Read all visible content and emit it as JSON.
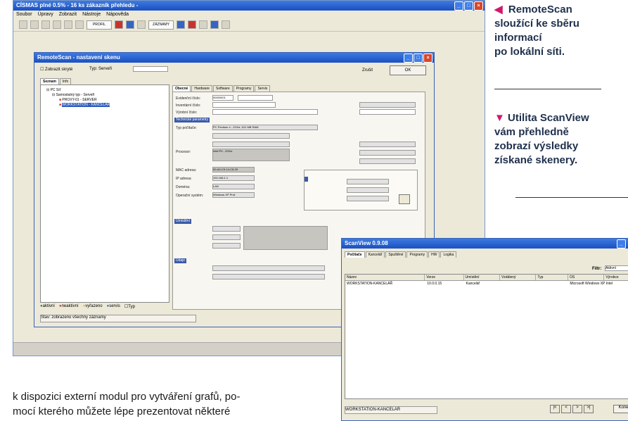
{
  "main_window": {
    "title": "CÍSMAS plné 0.5% - 16 ks zákazník přehledu - ",
    "menu": [
      "Soubor",
      "Úpravy",
      "Zobrazit",
      "Nástroje",
      "Nápověda"
    ],
    "toolbar_field": "PROFIL KANCELÁŘ",
    "toolbar_field2": "ZÁZNAMY"
  },
  "dialog": {
    "title": "RemoteScan - nastavení skenu",
    "checkbox_label": "Zobrazit skryté",
    "filter_label": "Typ: Serveři",
    "ok_label": "OK",
    "cancel_label": "Zrušit",
    "left_tabs": [
      "Seznam",
      "Info"
    ],
    "tree": [
      {
        "label": "PC Síť",
        "level": 0,
        "selected": false
      },
      {
        "label": "Samostatný typ - Serveři",
        "level": 1,
        "selected": false
      },
      {
        "label": "PROXY-01 - SERVER",
        "level": 2,
        "selected": false
      },
      {
        "label": "WORKSTATION - KANCELÁŘ",
        "level": 2,
        "selected": true
      }
    ],
    "tabs": [
      "Obecné",
      "Hardware",
      "Software",
      "Programy",
      "Servis"
    ],
    "general_fields": [
      {
        "label": "Evidenční číslo:",
        "value": "00000001"
      },
      {
        "label": "Inventární číslo:",
        "value": ""
      },
      {
        "label": "Výrobní číslo:",
        "value": ""
      }
    ],
    "section_headers": [
      "Technické parametry",
      "Umístění",
      "Údaje"
    ],
    "tech_fields": [
      {
        "label": "Typ počítače:",
        "value": "PC Pentium 4 - 2GHz, 512 MB RAM"
      },
      {
        "label": "Procesor:",
        "value": "Intel P4 - 2GHz"
      },
      {
        "label": "MAC adresa:",
        "value": "00-A0-C9-14-C8-29"
      },
      {
        "label": "IP adresa:",
        "value": "192.168.1.1"
      },
      {
        "label": "Doména:",
        "value": "LAN"
      },
      {
        "label": "Operační systém:",
        "value": "Windows XP Prof."
      }
    ],
    "status_legend": [
      "aktivní",
      "neaktivní",
      "vyřazeno",
      "servis",
      "Typ"
    ],
    "status_row": "Stav: zobrazeno všechny záznamy"
  },
  "captions": {
    "remotescan": [
      "RemoteScan",
      "sloužící ke sběru",
      "informací",
      "po lokální síti."
    ],
    "scanview": [
      "Utilita ScanView",
      "vám přehledně",
      "zobrazí výsledky",
      "získané skenery."
    ]
  },
  "body_text": {
    "line1": "k dispozici externí modul pro vytváření grafů, po-",
    "line2": "mocí kterého můžete lépe prezentovat některé"
  },
  "scanview": {
    "title": "ScanView 0.9.08",
    "tabs": [
      "Počítače",
      "Kancelář",
      "Spuštěné",
      "Programy",
      "HW",
      "Logika"
    ],
    "filter_label": "Filtr:",
    "filter_value": "Aktivní",
    "columns": [
      "Název",
      "Verze",
      "Umístění",
      "Vzdálený",
      "Typ",
      "OS",
      "Výrobce"
    ],
    "rows": [
      [
        "WORKSTATION-KANCELÁŘ",
        "10.0.0.15",
        "Kancelář",
        "",
        "",
        "Microsoft Windows XP",
        "Intel"
      ]
    ],
    "status": "WORKSTATION-KANCELÁŘ",
    "pager": [
      "|<",
      "<",
      ">",
      ">|"
    ],
    "close_label": "Konec"
  }
}
